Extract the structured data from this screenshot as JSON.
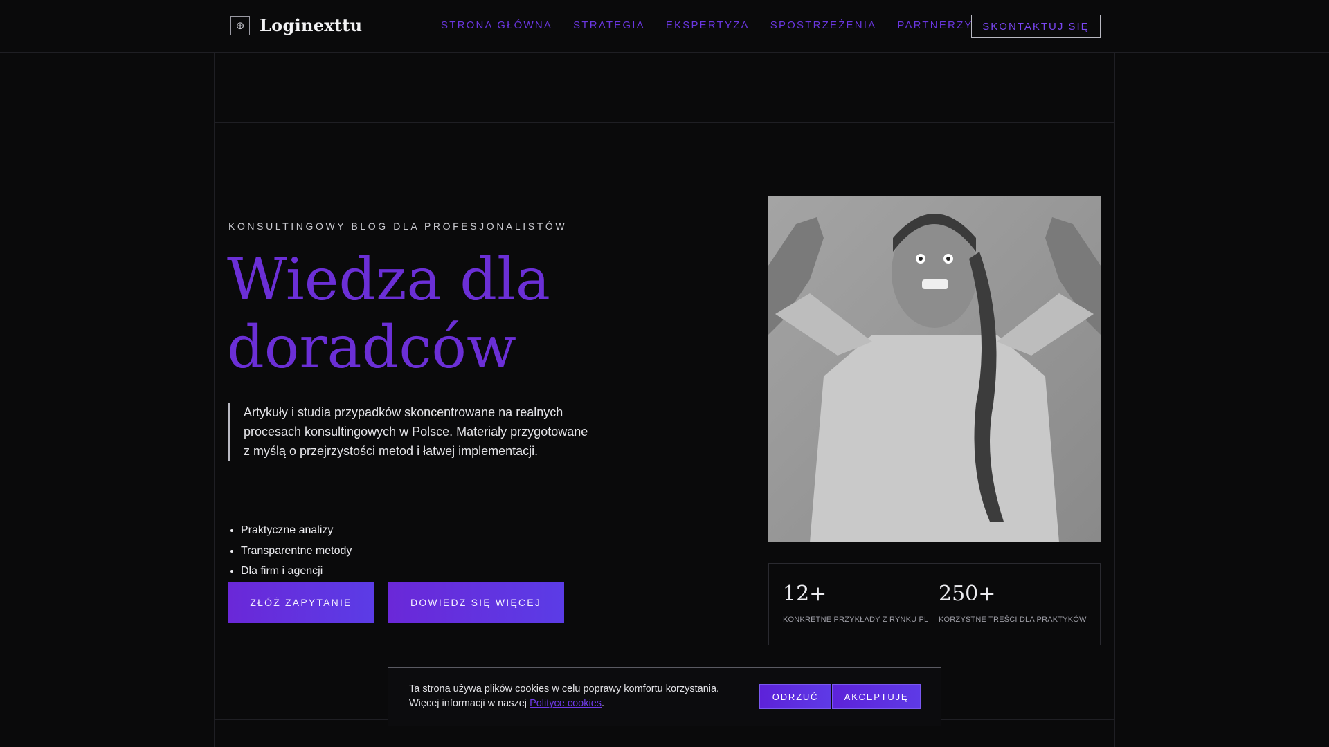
{
  "header": {
    "logo_icon": "globe-icon",
    "brand": "Loginexttu",
    "nav": [
      {
        "label": "STRONA GŁÓWNA"
      },
      {
        "label": "STRATEGIA"
      },
      {
        "label": "EKSPERTYZA"
      },
      {
        "label": "SPOSTRZEŻENIA"
      },
      {
        "label": "PARTNERZY"
      }
    ],
    "cta": "SKONTAKTUJ SIĘ"
  },
  "hero": {
    "eyebrow": "KONSULTINGOWY BLOG DLA PROFESJONALISTÓW",
    "title": "Wiedza dla doradców",
    "quote": "Artykuły i studia przypadków skoncentrowane na realnych procesach konsultingowych w Polsce. Materiały przygotowane z myślą o przejrzystości metod i łatwej implementacji.",
    "bullets": [
      "Praktyczne analizy",
      "Transparentne metody",
      "Dla firm i agencji"
    ],
    "primary_button": "ZŁÓŻ ZAPYTANIE",
    "secondary_button": "DOWIEDZ SIĘ WIĘCEJ"
  },
  "stats": [
    {
      "value": "12+",
      "label": "KONKRETNE PRZYKŁADY Z RYNKU PL"
    },
    {
      "value": "250+",
      "label": "KORZYSTNE TREŚCI DLA PRAKTYKÓW"
    }
  ],
  "cookie": {
    "text_line1": "Ta strona używa plików cookies w celu poprawy komfortu korzystania.",
    "text_line2": "Więcej informacji w naszej",
    "link": "Polityce cookies",
    "after_link": ".",
    "reject": "ODRZUĆ",
    "accept": "AKCEPTUJĘ"
  },
  "colors": {
    "background": "#0a0a0b",
    "accent": "#6b2fd6",
    "button_gradient_end": "#5b3ce6"
  }
}
